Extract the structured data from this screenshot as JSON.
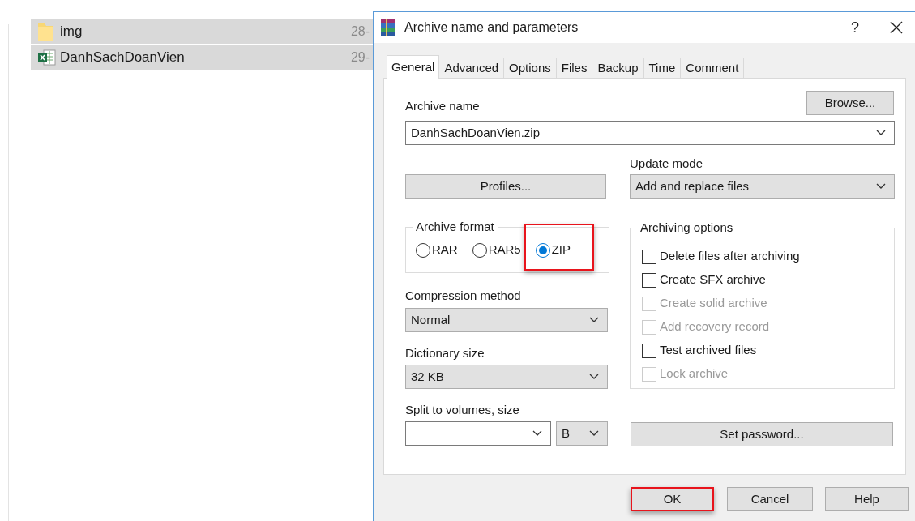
{
  "explorer": {
    "rows": [
      {
        "name": "img",
        "kind": "folder",
        "date": "28-",
        "selected": true
      },
      {
        "name": "DanhSachDoanVien",
        "kind": "spreadsheet",
        "date": "29-",
        "selected": true
      }
    ]
  },
  "dialog": {
    "title": "Archive name and parameters",
    "help": "?",
    "tabs": [
      {
        "label": "General",
        "selected": true
      },
      {
        "label": "Advanced",
        "selected": false
      },
      {
        "label": "Options",
        "selected": false
      },
      {
        "label": "Files",
        "selected": false
      },
      {
        "label": "Backup",
        "selected": false
      },
      {
        "label": "Time",
        "selected": false
      },
      {
        "label": "Comment",
        "selected": false
      }
    ],
    "archive_name": {
      "label": "Archive name",
      "value": "DanhSachDoanVien.zip"
    },
    "browse": "Browse...",
    "profiles": "Profiles...",
    "update_mode": {
      "label": "Update mode",
      "value": "Add and replace files"
    },
    "archive_format": {
      "label": "Archive format",
      "options": [
        {
          "label": "RAR",
          "selected": false,
          "highlighted": false
        },
        {
          "label": "RAR5",
          "selected": false,
          "highlighted": false
        },
        {
          "label": "ZIP",
          "selected": true,
          "highlighted": true
        }
      ]
    },
    "compression_method": {
      "label": "Compression method",
      "value": "Normal"
    },
    "dictionary_size": {
      "label": "Dictionary size",
      "value": "32 KB"
    },
    "split": {
      "label": "Split to volumes, size",
      "unit": "B"
    },
    "archiving_options": {
      "label": "Archiving options",
      "items": [
        {
          "label": "Delete files after archiving",
          "checked": false,
          "disabled": false
        },
        {
          "label": "Create SFX archive",
          "checked": false,
          "disabled": false
        },
        {
          "label": "Create solid archive",
          "checked": false,
          "disabled": true
        },
        {
          "label": "Add recovery record",
          "checked": false,
          "disabled": true
        },
        {
          "label": "Test archived files",
          "checked": false,
          "disabled": false
        },
        {
          "label": "Lock archive",
          "checked": false,
          "disabled": true
        }
      ]
    },
    "set_password": "Set password...",
    "buttons": [
      {
        "label": "OK",
        "highlighted": true
      },
      {
        "label": "Cancel",
        "highlighted": false
      },
      {
        "label": "Help",
        "highlighted": false
      }
    ]
  }
}
